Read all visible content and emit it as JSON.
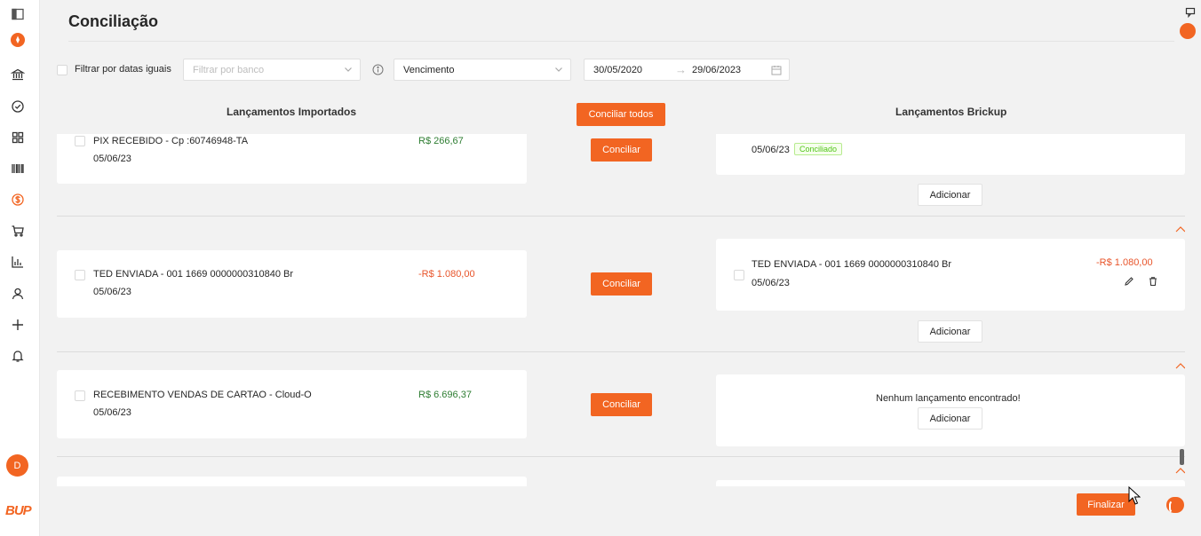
{
  "page": {
    "title": "Conciliação"
  },
  "sidebar": {
    "icons": [
      "sidebar-toggle-icon",
      "rocket-icon",
      "bank-icon",
      "check-circle-icon",
      "dashboard-icon",
      "barcode-icon",
      "dollar-icon",
      "cart-icon",
      "chart-icon",
      "user-icon",
      "plus-icon",
      "bell-icon"
    ],
    "avatar_letter": "D",
    "logo": "BUP"
  },
  "filters": {
    "same_dates_label": "Filtrar por datas iguais",
    "bank_placeholder": "Filtrar por banco",
    "date_type": "Vencimento",
    "date_from": "30/05/2020",
    "date_to": "29/06/2023"
  },
  "columns": {
    "imported": "Lançamentos Importados",
    "brickup": "Lançamentos Brickup",
    "reconcile_all": "Conciliar todos"
  },
  "rows": [
    {
      "imported": {
        "description": "PIX RECEBIDO - Cp :60746948-TA",
        "date": "05/06/23",
        "value": "R$ 266,67"
      },
      "reconcile_label": "Conciliar",
      "brickup": {
        "date": "05/06/23",
        "badge": "Conciliado"
      },
      "add_label": "Adicionar"
    },
    {
      "imported": {
        "description": "TED ENVIADA - 001 1669 0000000310840 Br",
        "date": "05/06/23",
        "value": "-R$ 1.080,00"
      },
      "reconcile_label": "Conciliar",
      "brickup": {
        "description": "TED ENVIADA - 001 1669 0000000310840 Br",
        "date": "05/06/23",
        "value": "-R$ 1.080,00"
      },
      "add_label": "Adicionar"
    },
    {
      "imported": {
        "description": "RECEBIMENTO VENDAS DE CARTAO - Cloud-O",
        "date": "05/06/23",
        "value": "R$ 6.696,37"
      },
      "reconcile_label": "Conciliar",
      "brickup": {
        "empty": "Nenhum lançamento encontrado!"
      },
      "add_label": "Adicionar"
    }
  ],
  "footer": {
    "finish": "Finalizar"
  },
  "colors": {
    "accent": "#f26522",
    "positive": "#2e7d32",
    "negative": "#e8542a"
  }
}
